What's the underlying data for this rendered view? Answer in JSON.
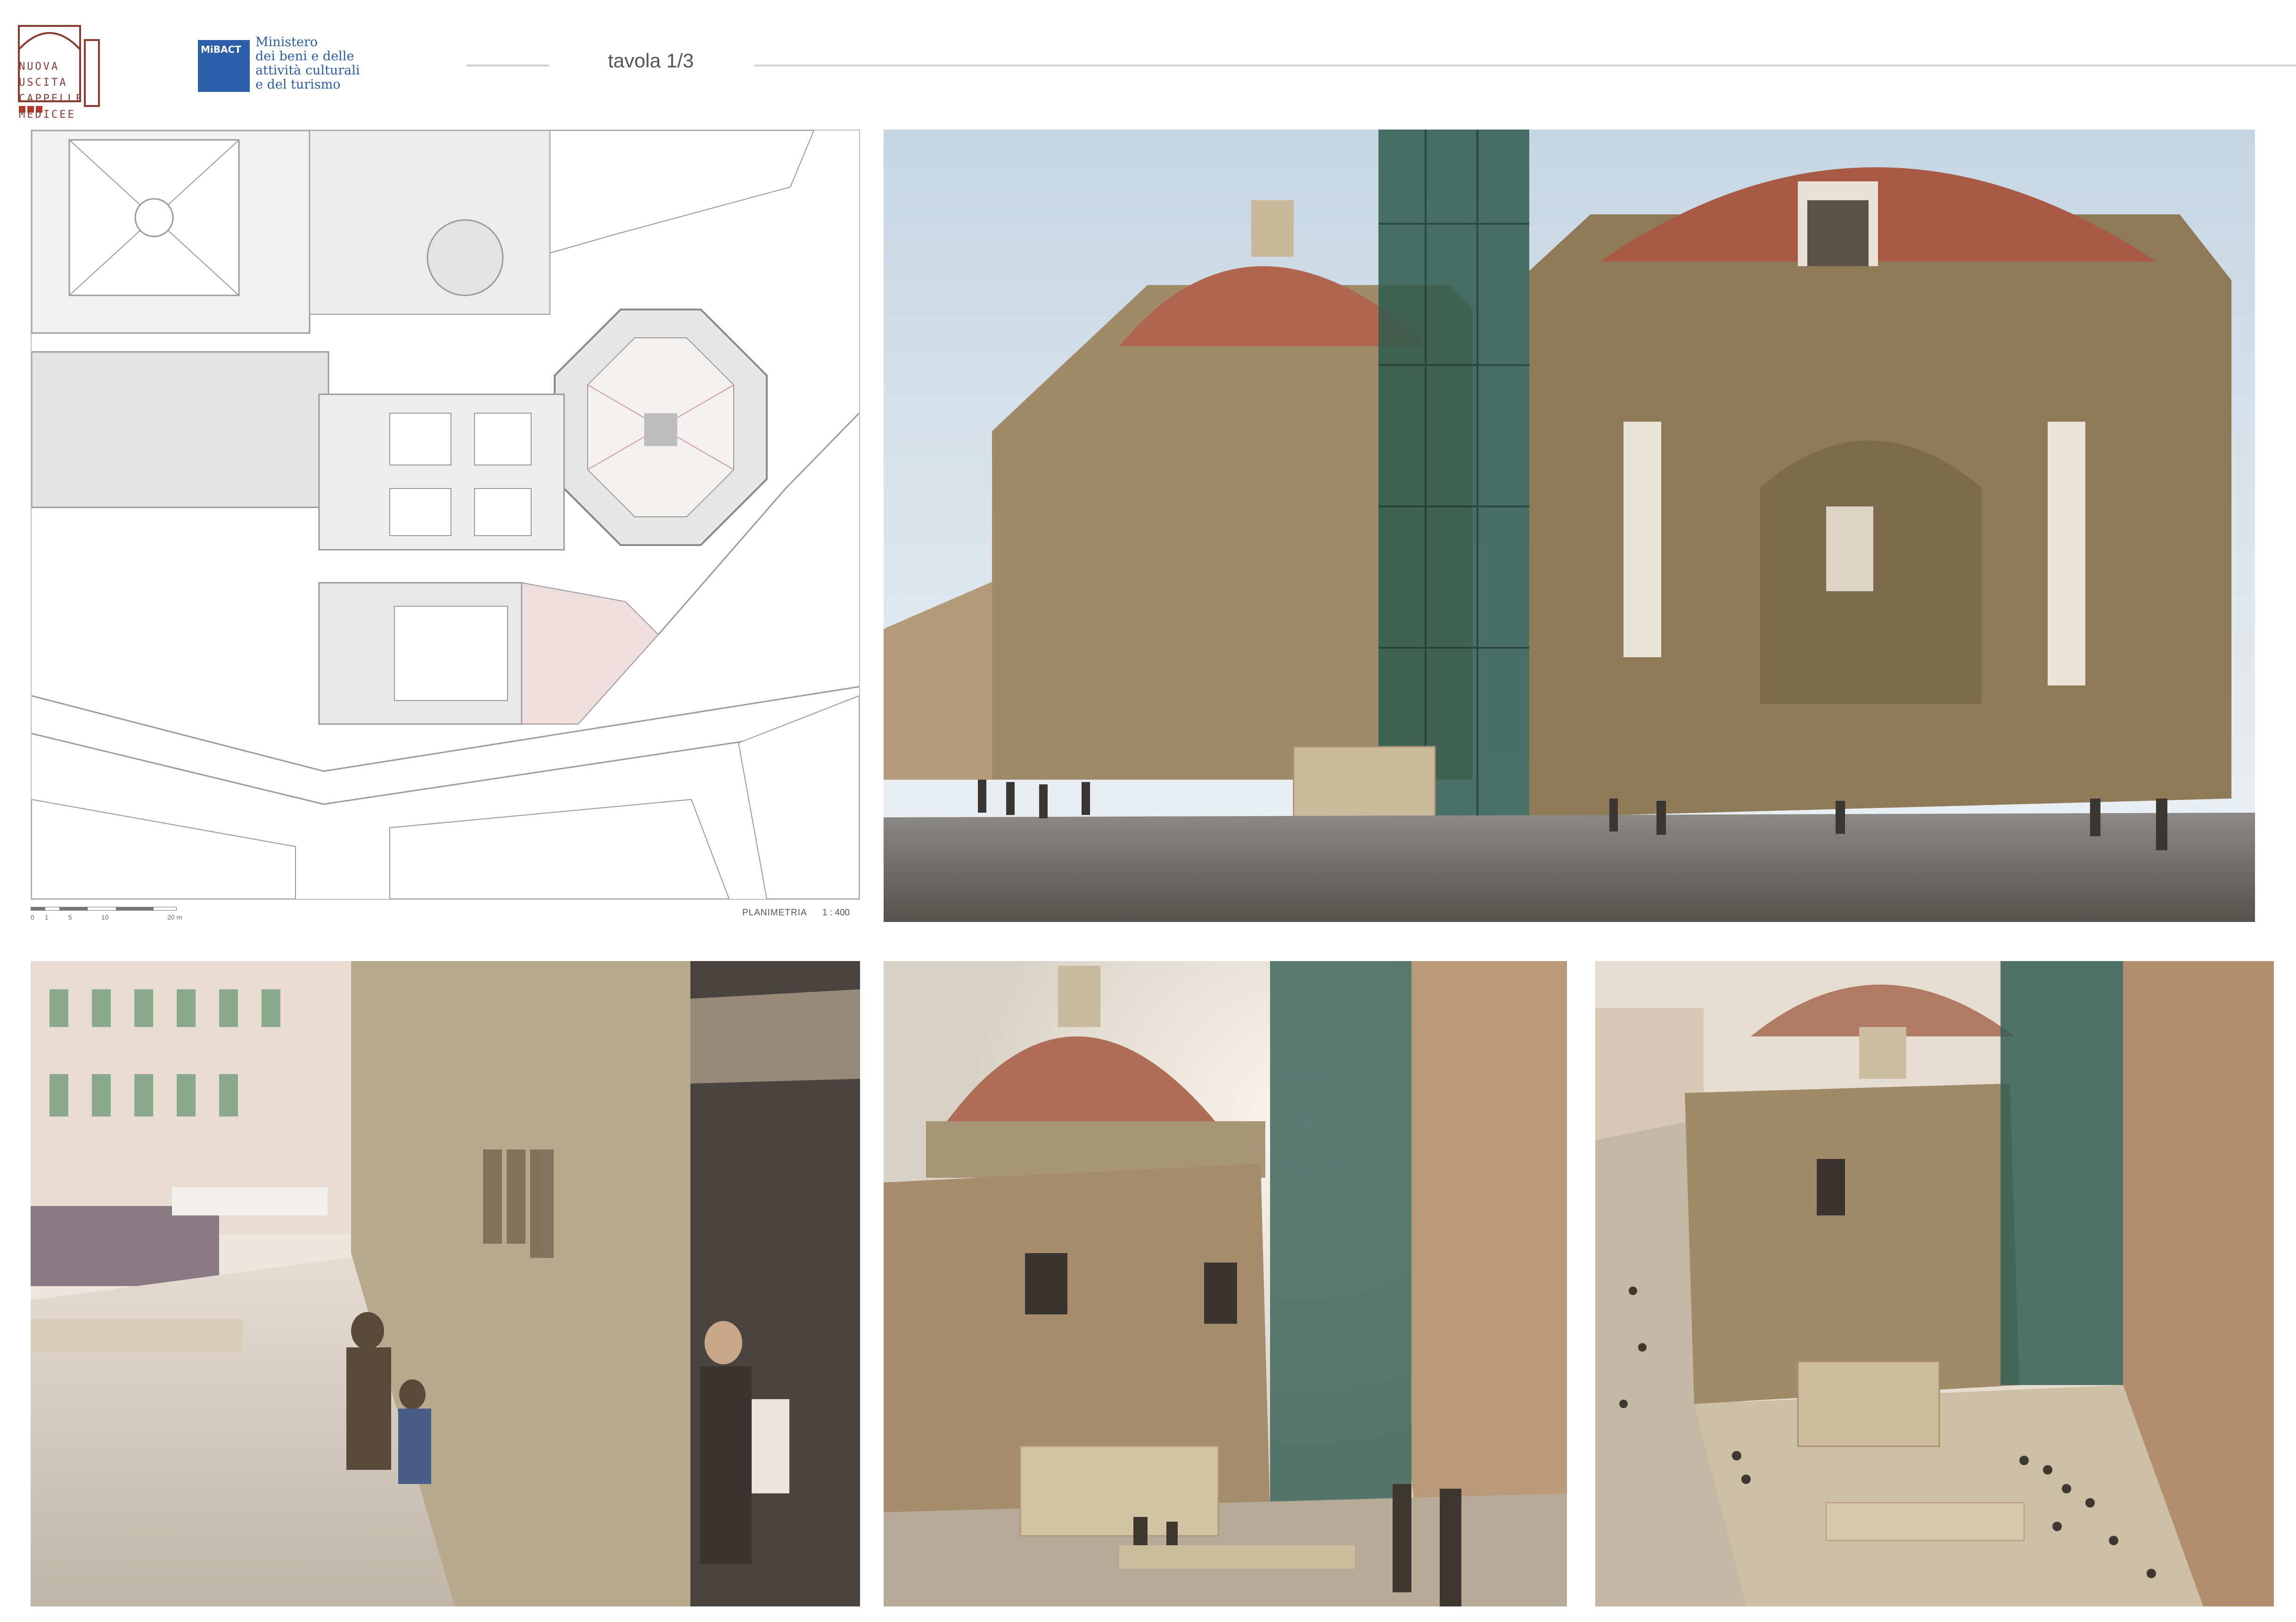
{
  "header": {
    "project_logo_lines": [
      "NUOVA",
      "USCITA",
      "CAPPELLE",
      "MEDICEE"
    ],
    "ministry_mark": "MiBACT",
    "ministry_lines": [
      "Ministero",
      "dei beni e delle",
      "attività culturali",
      "e del turismo"
    ],
    "title": "tavola 1/3"
  },
  "site_plan": {
    "scale_ticks": [
      "0",
      "1",
      "5",
      "10",
      "20 m"
    ],
    "name": "PLANIMETRIA",
    "scale": "1 : 400"
  },
  "palette": {
    "plan_fill": "#e4e4e4",
    "plan_line": "#9a9a9a",
    "sky": "#cfdbe6",
    "stone": "#9c8a6a",
    "dome": "#b0664e",
    "scaffold": "#2f5a4e"
  }
}
